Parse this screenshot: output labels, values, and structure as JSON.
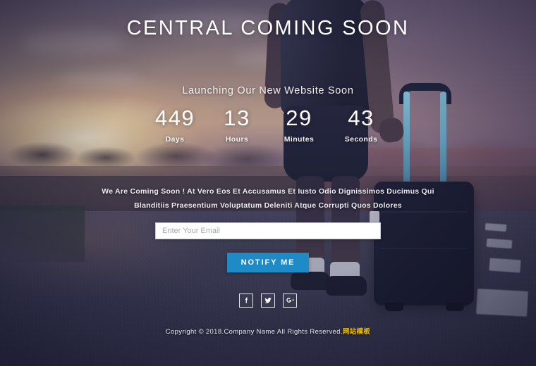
{
  "page": {
    "title": "CENTRAL COMING SOON",
    "tagline": "Launching Our New Website Soon"
  },
  "countdown": {
    "units": [
      {
        "value": "449",
        "label": "Days"
      },
      {
        "value": "13",
        "label": "Hours"
      },
      {
        "value": "29",
        "label": "Minutes"
      },
      {
        "value": "43",
        "label": "Seconds"
      }
    ]
  },
  "blurb": {
    "line1": "We Are Coming Soon ! At Vero Eos Et Accusamus Et Iusto Odio Dignissimos Ducimus Qui",
    "line2": "Blanditiis Praesentium Voluptatum Deleniti Atque Corrupti Quos Dolores"
  },
  "subscribe": {
    "email_placeholder": "Enter Your Email",
    "email_value": "",
    "button_label": "NOTIFY ME"
  },
  "socials": [
    {
      "name": "facebook-icon",
      "label": "f"
    },
    {
      "name": "twitter-icon",
      "label": "t"
    },
    {
      "name": "google-plus-icon",
      "label": "G+"
    }
  ],
  "footer": {
    "copyright": "Copyright © 2018.Company Name All Rights Reserved.",
    "mark": "网站模板"
  },
  "colors": {
    "accent_button": "#1f8bc6",
    "mark": "#f2c200",
    "text": "#ffffff",
    "road": "#3a3a50",
    "suitcase_handle": "#6fb6d2"
  }
}
